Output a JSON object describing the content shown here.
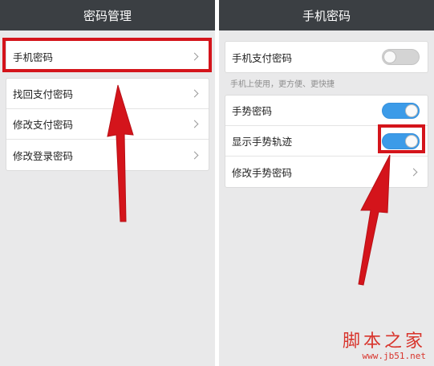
{
  "left_screen": {
    "title": "密码管理",
    "group1": [
      {
        "label": "手机密码",
        "chevron": true
      }
    ],
    "group2": [
      {
        "label": "找回支付密码",
        "chevron": true
      },
      {
        "label": "修改支付密码",
        "chevron": true
      },
      {
        "label": "修改登录密码",
        "chevron": true
      }
    ]
  },
  "right_screen": {
    "title": "手机密码",
    "payment_row": {
      "label": "手机支付密码",
      "toggle": "off"
    },
    "hint": "手机上使用，更方便、更快捷",
    "gesture_rows": [
      {
        "label": "手势密码",
        "toggle": "on"
      },
      {
        "label": "显示手势轨迹",
        "toggle": "on"
      },
      {
        "label": "修改手势密码",
        "chevron": true
      }
    ]
  },
  "annotation": {
    "color": "#d4141b"
  },
  "watermark": {
    "text": "脚本之家",
    "url": "www.jb51.net"
  },
  "colors": {
    "titlebar": "#3b3f43",
    "background": "#e9e9ea",
    "toggle_on": "#3c9be8",
    "toggle_off": "#d4d4d4"
  }
}
